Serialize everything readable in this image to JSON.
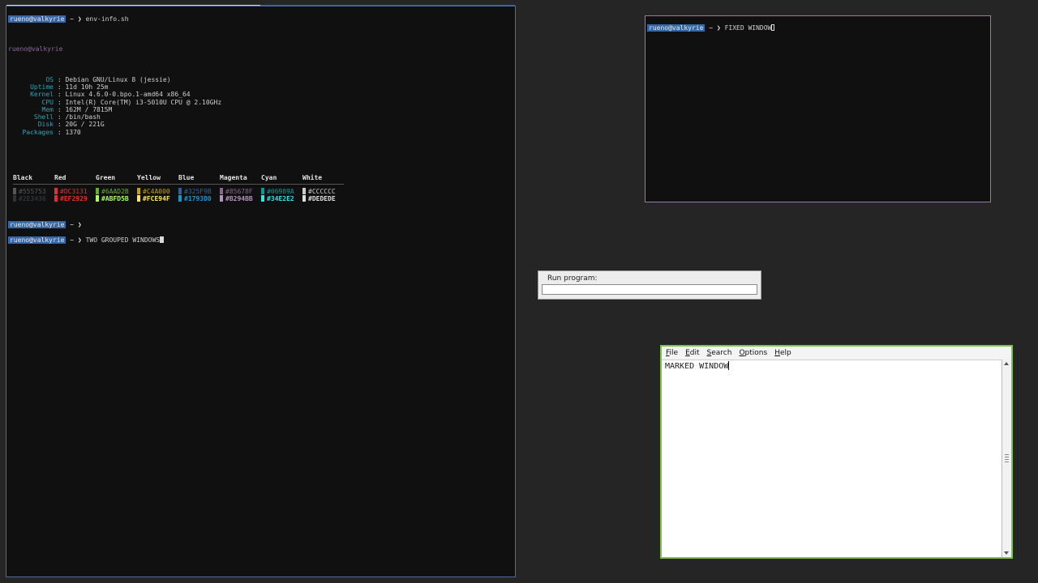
{
  "main_terminal": {
    "cmd_user": "rueno@valkyrie",
    "cmd_tilde": "~",
    "cmd_arrow": "❯",
    "command": "env-info.sh",
    "header_user": "rueno@valkyrie",
    "info": [
      {
        "key": "OS",
        "value": "Debian GNU/Linux 8 (jessie)"
      },
      {
        "key": "Uptime",
        "value": "11d 10h 25m"
      },
      {
        "key": "Kernel",
        "value": "Linux 4.6.0-0.bpo.1-amd64 x86_64"
      },
      {
        "key": "CPU",
        "value": "Intel(R) Core(TM) i3-5010U CPU @ 2.10GHz"
      },
      {
        "key": "Mem",
        "value": "162M / 7815M"
      },
      {
        "key": "Shell",
        "value": "/bin/bash"
      },
      {
        "key": "Disk",
        "value": "20G / 221G"
      },
      {
        "key": "Packages",
        "value": "1370"
      }
    ],
    "sep": ":",
    "palette": [
      {
        "name": "Black",
        "normal": "#555753",
        "bright": "#2E3436"
      },
      {
        "name": "Red",
        "normal": "#DC3131",
        "bright": "#EF2929"
      },
      {
        "name": "Green",
        "normal": "#6AAD2B",
        "bright": "#ABFD5B"
      },
      {
        "name": "Yellow",
        "normal": "#C4A000",
        "bright": "#FCE94F"
      },
      {
        "name": "Blue",
        "normal": "#325F9B",
        "bright": "#1793D0"
      },
      {
        "name": "Magenta",
        "normal": "#85678F",
        "bright": "#B294BB"
      },
      {
        "name": "Cyan",
        "normal": "#06989A",
        "bright": "#34E2E2"
      },
      {
        "name": "White",
        "normal": "#CCCCCC",
        "bright": "#DEDEDE"
      }
    ],
    "prompt1_user": "rueno@valkyrie",
    "prompt2_user": "rueno@valkyrie",
    "typed": "TWO GROUPED WINDOWS"
  },
  "fixed_terminal": {
    "user": "rueno@valkyrie",
    "tilde": "~",
    "arrow": "❯",
    "typed": "FIXED WINDOW"
  },
  "run_dialog": {
    "label": "Run program:",
    "value": ""
  },
  "editor": {
    "menu": [
      "File",
      "Edit",
      "Search",
      "Options",
      "Help"
    ],
    "text": "MARKED WINDOW"
  },
  "colors": {
    "desktop_bg": "#252525",
    "terminal_bg": "#101010",
    "main_border": "#4a6aa8",
    "fixed_border": "#9a7aa8",
    "marked_border": "#7fc244",
    "prompt_bg": "#3466a8"
  }
}
